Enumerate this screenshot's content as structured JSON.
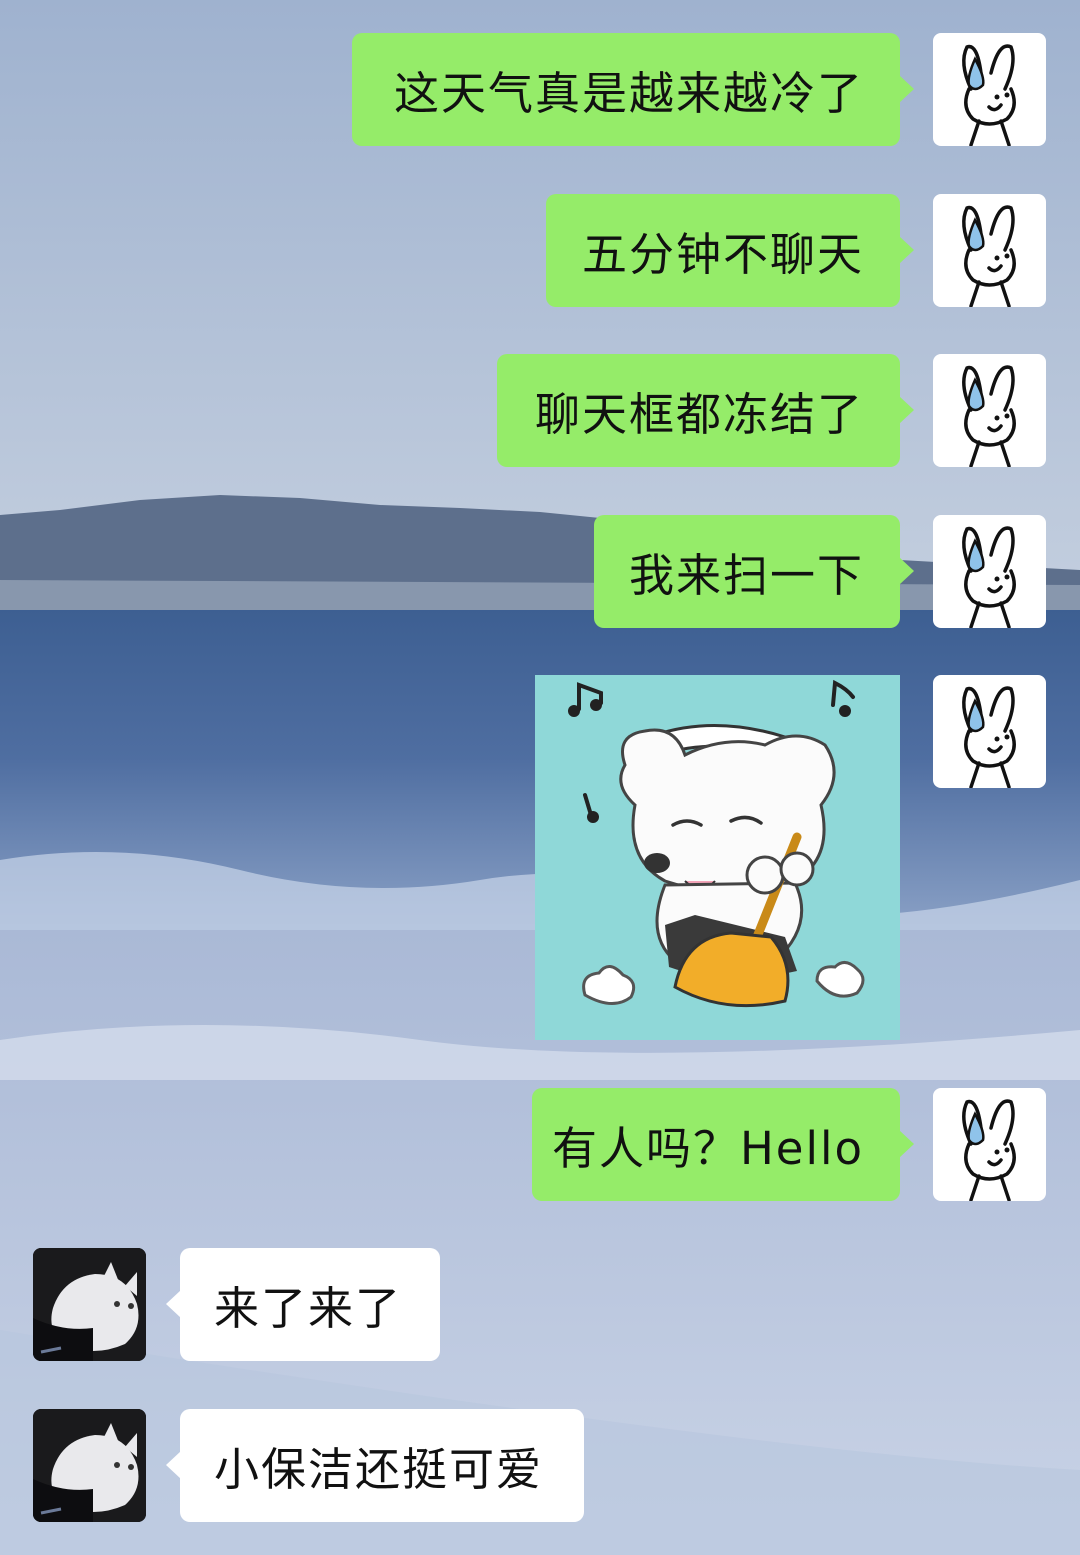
{
  "conversation": {
    "messages": [
      {
        "sender": "me",
        "type": "text",
        "text": "这天气真是越来越冷了"
      },
      {
        "sender": "me",
        "type": "text",
        "text": "五分钟不聊天"
      },
      {
        "sender": "me",
        "type": "text",
        "text": "聊天框都冻结了"
      },
      {
        "sender": "me",
        "type": "text",
        "text": "我来扫一下"
      },
      {
        "sender": "me",
        "type": "sticker",
        "sticker": "sweeping-maid-dog-sticker"
      },
      {
        "sender": "me",
        "type": "text",
        "text": "有人吗？Hello"
      },
      {
        "sender": "other",
        "type": "text",
        "text": "来了来了"
      },
      {
        "sender": "other",
        "type": "text",
        "text": "小保洁还挺可爱"
      }
    ]
  },
  "avatars": {
    "me": "sweat-bunny-doodle-avatar",
    "other": "white-cat-photo-avatar"
  },
  "colors": {
    "my_bubble": "#95ec69",
    "other_bubble": "#ffffff",
    "text": "#111111"
  },
  "background": "seaside-waves-wallpaper"
}
